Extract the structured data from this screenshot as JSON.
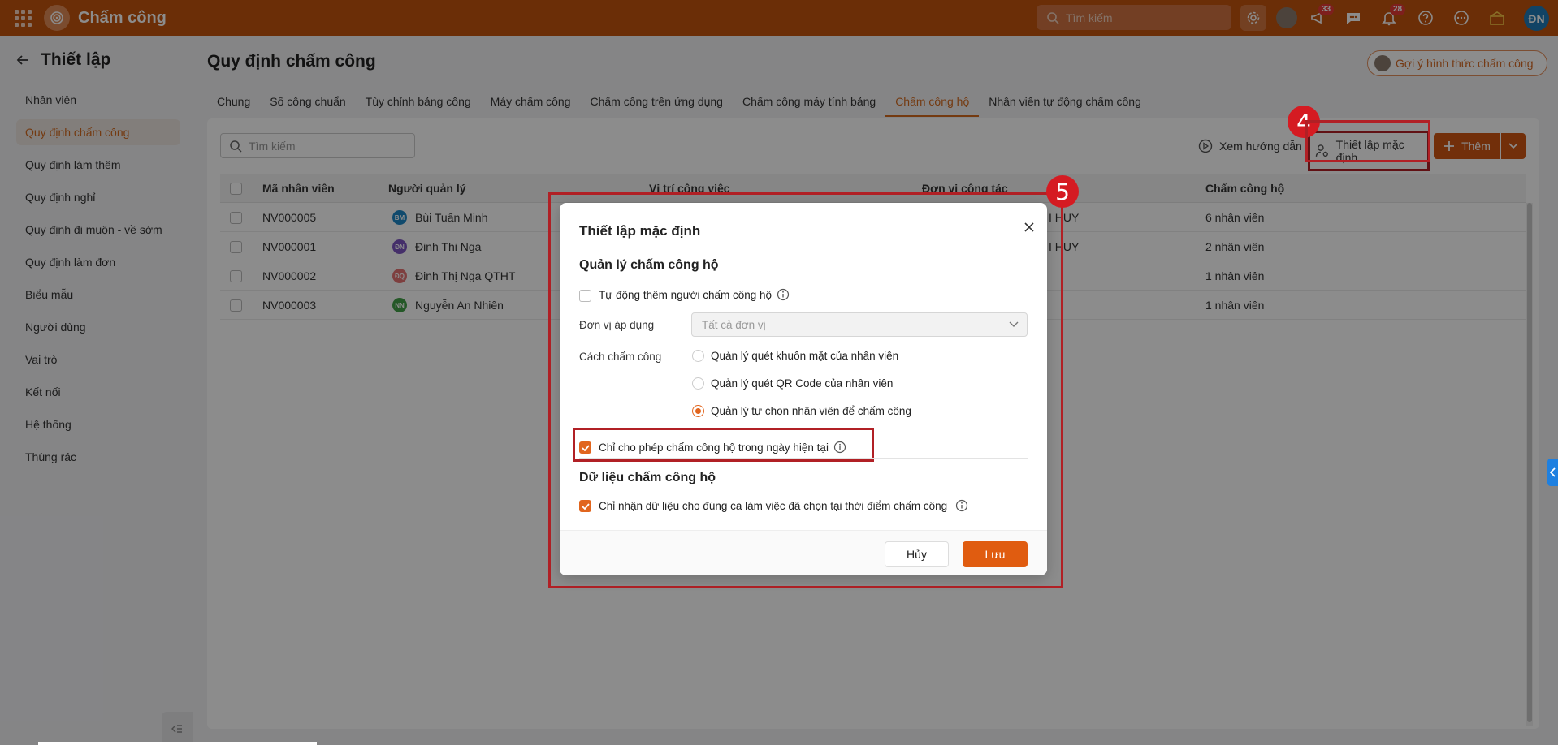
{
  "app": {
    "title": "Chấm công"
  },
  "topbar": {
    "search_placeholder": "Tìm kiếm",
    "announcements_badge": "33",
    "notifications_badge": "28",
    "user_initials": "ĐN"
  },
  "sidebar": {
    "title": "Thiết lập",
    "items": [
      {
        "label": "Nhân viên"
      },
      {
        "label": "Quy định chấm công"
      },
      {
        "label": "Quy định làm thêm"
      },
      {
        "label": "Quy định nghỉ"
      },
      {
        "label": "Quy định đi muộn - về sớm"
      },
      {
        "label": "Quy định làm đơn"
      },
      {
        "label": "Biểu mẫu"
      },
      {
        "label": "Người dùng"
      },
      {
        "label": "Vai trò"
      },
      {
        "label": "Kết nối"
      },
      {
        "label": "Hệ thống"
      },
      {
        "label": "Thùng rác"
      }
    ]
  },
  "main": {
    "title": "Quy định chấm công",
    "suggest_button": "Gợi ý hình thức chấm công",
    "tabs": [
      {
        "label": "Chung"
      },
      {
        "label": "Số công chuẩn"
      },
      {
        "label": "Tùy chỉnh bảng công"
      },
      {
        "label": "Máy chấm công"
      },
      {
        "label": "Chấm công trên ứng dụng"
      },
      {
        "label": "Chấm công máy tính bảng"
      },
      {
        "label": "Chấm công hộ"
      },
      {
        "label": "Nhân viên tự động chấm công"
      }
    ],
    "toolbar": {
      "search_placeholder": "Tìm kiếm",
      "guide": "Xem hướng dẫn",
      "default_settings": "Thiết lập mặc định",
      "add": "Thêm"
    },
    "table": {
      "columns": [
        "Mã nhân viên",
        "Người quản lý",
        "Vị trí công việc",
        "Đơn vị công tác",
        "Chấm công hộ"
      ],
      "rows": [
        {
          "code": "NV000005",
          "initials": "BM",
          "avatar_color": "#1e88c7",
          "manager": "Bùi Tuấn Minh",
          "unit": "I HUY",
          "count": "6 nhân viên"
        },
        {
          "code": "NV000001",
          "initials": "ĐN",
          "avatar_color": "#7e57c2",
          "manager": "Đinh Thị Nga",
          "unit": "I HUY",
          "count": "2 nhân viên"
        },
        {
          "code": "NV000002",
          "initials": "ĐQ",
          "avatar_color": "#e57373",
          "manager": "Đinh Thị Nga QTHT",
          "unit": "",
          "count": "1 nhân viên"
        },
        {
          "code": "NV000003",
          "initials": "NN",
          "avatar_color": "#43a047",
          "manager": "Nguyễn An Nhiên",
          "unit": "",
          "count": "1 nhân viên"
        }
      ]
    }
  },
  "markers": {
    "toolbar": "4",
    "modal": "5"
  },
  "modal": {
    "title": "Thiết lập mặc định",
    "section1": "Quản lý chấm công hộ",
    "auto_add": "Tự động thêm người chấm công hộ",
    "unit_label": "Đơn vị áp dụng",
    "unit_value": "Tất cả đơn vị",
    "method_label": "Cách chấm công",
    "methods": [
      {
        "label": "Quản lý quét khuôn mặt của nhân viên"
      },
      {
        "label": "Quản lý quét QR Code của nhân viên"
      },
      {
        "label": "Quản lý tự chọn nhân viên để chấm công"
      }
    ],
    "today_only": "Chỉ cho phép chấm công hộ trong ngày hiện tại",
    "section2": "Dữ liệu chấm công hộ",
    "shift_only": "Chỉ nhận dữ liệu cho đúng ca làm việc đã chọn tại thời điểm chấm công",
    "cancel": "Hủy",
    "save": "Lưu"
  },
  "colors": {
    "brand": "#c3540e",
    "accent": "#e1651e",
    "highlight": "#b12025"
  }
}
